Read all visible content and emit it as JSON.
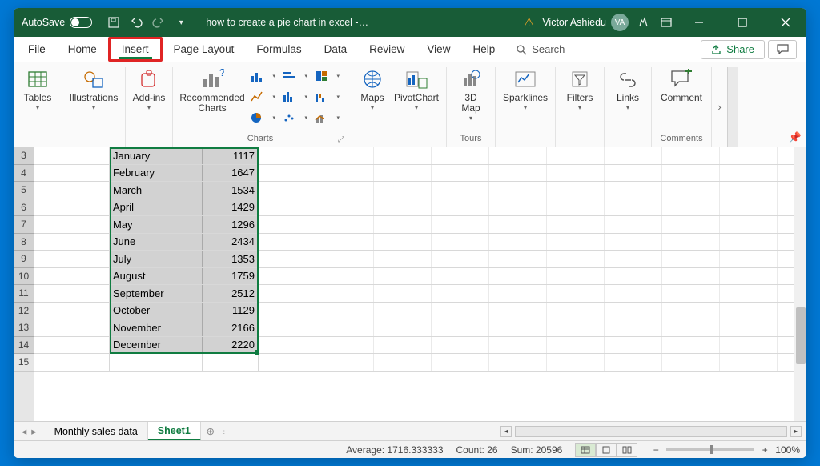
{
  "titlebar": {
    "autosave_label": "AutoSave",
    "autosave_state": "Off",
    "doc_title": "how to create a pie chart in excel  -…",
    "user_name": "Victor Ashiedu",
    "user_initials": "VA"
  },
  "tabs": {
    "items": [
      "File",
      "Home",
      "Insert",
      "Page Layout",
      "Formulas",
      "Data",
      "Review",
      "View",
      "Help"
    ],
    "active_index": 2,
    "search_placeholder": "Search",
    "share_label": "Share"
  },
  "ribbon": {
    "tables": {
      "label": "Tables"
    },
    "illustrations": {
      "label": "Illustrations"
    },
    "addins": {
      "label": "Add-ins"
    },
    "recommended": {
      "label": "Recommended\nCharts"
    },
    "maps": {
      "label": "Maps"
    },
    "pivotchart": {
      "label": "PivotChart"
    },
    "map3d": {
      "label": "3D\nMap"
    },
    "sparklines": {
      "label": "Sparklines"
    },
    "filters": {
      "label": "Filters"
    },
    "links": {
      "label": "Links"
    },
    "comment": {
      "label": "Comment"
    },
    "group_charts": "Charts",
    "group_tours": "Tours",
    "group_comments": "Comments"
  },
  "sheet": {
    "selection_range": "B3:C14",
    "row_headers": [
      3,
      4,
      5,
      6,
      7,
      8,
      9,
      10,
      11,
      12,
      13,
      14,
      15
    ],
    "rows": [
      {
        "b": "January",
        "c": 1117
      },
      {
        "b": "February",
        "c": 1647
      },
      {
        "b": "March",
        "c": 1534
      },
      {
        "b": "April",
        "c": 1429
      },
      {
        "b": "May",
        "c": 1296
      },
      {
        "b": "June",
        "c": 2434
      },
      {
        "b": "July",
        "c": 1353
      },
      {
        "b": "August",
        "c": 1759
      },
      {
        "b": "September",
        "c": 2512
      },
      {
        "b": "October",
        "c": 1129
      },
      {
        "b": "November",
        "c": 2166
      },
      {
        "b": "December",
        "c": 2220
      }
    ],
    "tabs": [
      "Monthly sales data",
      "Sheet1"
    ],
    "active_tab": 1
  },
  "status": {
    "average_label": "Average:",
    "average_value": "1716.333333",
    "count_label": "Count:",
    "count_value": "26",
    "sum_label": "Sum:",
    "sum_value": "20596",
    "zoom": "100%"
  }
}
